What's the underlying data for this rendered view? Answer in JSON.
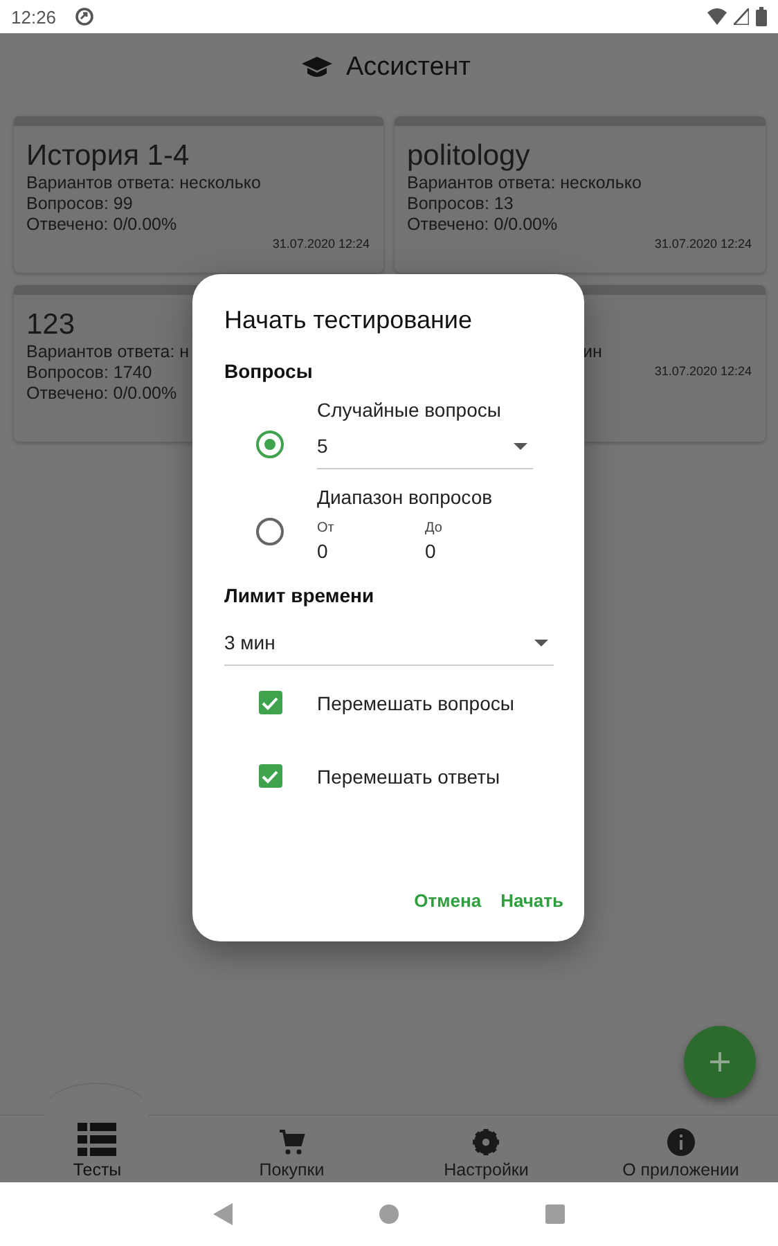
{
  "status_bar": {
    "time": "12:26"
  },
  "app_bar": {
    "title": "Ассистент"
  },
  "cards": [
    {
      "title": "История 1-4",
      "lines": [
        "Вариантов ответа: несколько",
        "Вопросов: 99",
        "Отвечено: 0/0.00%"
      ],
      "date": "31.07.2020 12:24",
      "cut_start": false
    },
    {
      "title": "politology",
      "lines": [
        "Вариантов ответа: несколько",
        "Вопросов: 13",
        "Отвечено: 0/0.00%"
      ],
      "date": "31.07.2020 12:24",
      "cut_start": false
    },
    {
      "title": "123",
      "lines": [
        "Вариантов ответа: н",
        "Вопросов: 1740",
        "Отвечено: 0/0.00%"
      ],
      "cut_start": false
    },
    {
      "lines": [
        "ин"
      ],
      "date": "31.07.2020 12:24",
      "cut_start": true
    }
  ],
  "dialog": {
    "title": "Начать тестирование",
    "questions_label": "Вопросы",
    "modes": [
      {
        "kind": "select",
        "label": "Случайные вопросы",
        "selected": true,
        "value": "5"
      },
      {
        "kind": "range",
        "label": "Диапазон вопросов",
        "selected": false,
        "from_label": "От",
        "from_value": "0",
        "to_label": "До",
        "to_value": "0"
      }
    ],
    "time_label": "Лимит времени",
    "time_value": "3 мин",
    "options": [
      {
        "label": "Перемешать вопросы",
        "checked": true
      },
      {
        "label": "Перемешать ответы",
        "checked": true
      }
    ],
    "buttons": [
      "Отмена",
      "Начать"
    ]
  },
  "bottom_nav": [
    {
      "label": "Тесты",
      "selected": true
    },
    {
      "label": "Покупки",
      "selected": false
    },
    {
      "label": "Настройки",
      "selected": false
    },
    {
      "label": "О приложении",
      "selected": false
    }
  ]
}
